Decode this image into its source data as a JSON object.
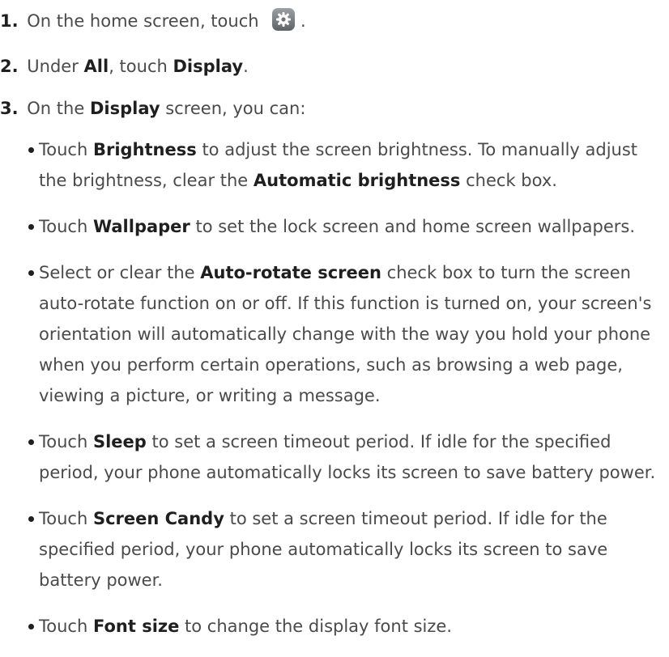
{
  "steps": [
    {
      "num": "1.",
      "pre": "On the home screen, touch",
      "post": "."
    },
    {
      "num": "2.",
      "pre": "Under",
      "b1": "All",
      "mid": ", touch",
      "b2": "Display",
      "post": "."
    },
    {
      "num": "3.",
      "pre": "On the",
      "b1": "Display",
      "post": "screen, you can:"
    }
  ],
  "bullets": [
    {
      "pre": "Touch",
      "b1": "Brightness",
      "mid1": "to adjust the screen brightness. To manually adjust the brightness, clear the",
      "b2": "Automatic brightness",
      "post": "check box."
    },
    {
      "pre": "Touch",
      "b1": "Wallpaper",
      "post": "to set the lock screen and home screen wallpapers."
    },
    {
      "pre": "Select or clear the",
      "b1": "Auto-rotate screen",
      "post": "check box to turn the screen auto-rotate function on or off. If this function is turned on, your screen's orientation will automatically change with the way you hold your phone when you perform certain operations, such as browsing a web page, viewing a picture, or writing a message."
    },
    {
      "pre": "Touch",
      "b1": "Sleep",
      "post": "to set a screen timeout period. If idle for the specified period, your phone automatically locks its screen to save battery power."
    },
    {
      "pre": "Touch",
      "b1": "Screen Candy",
      "post": "to set a screen timeout period. If idle for the specified period, your phone automatically locks its screen to save battery power."
    },
    {
      "pre": "Touch",
      "b1": "Font size",
      "post": "to change the display font size."
    }
  ]
}
